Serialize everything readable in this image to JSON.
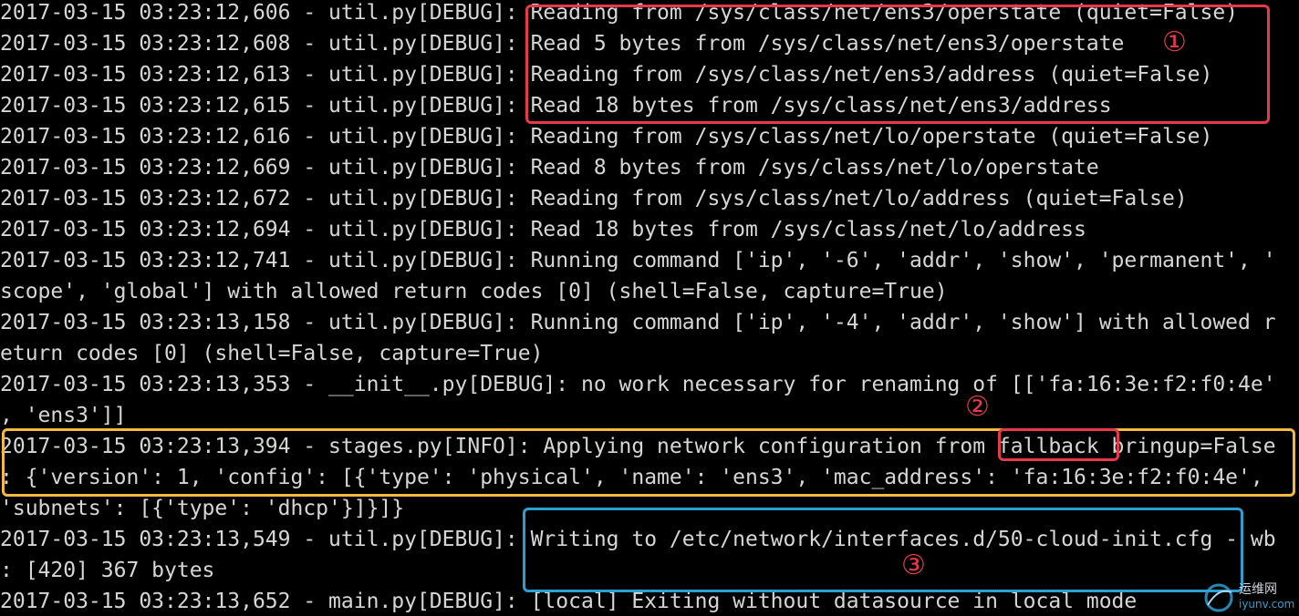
{
  "terminal": {
    "lines": [
      "2017-03-15 03:23:12,606 - util.py[DEBUG]: Reading from /sys/class/net/ens3/operstate (quiet=False)",
      "2017-03-15 03:23:12,608 - util.py[DEBUG]: Read 5 bytes from /sys/class/net/ens3/operstate",
      "2017-03-15 03:23:12,613 - util.py[DEBUG]: Reading from /sys/class/net/ens3/address (quiet=False)",
      "2017-03-15 03:23:12,615 - util.py[DEBUG]: Read 18 bytes from /sys/class/net/ens3/address",
      "2017-03-15 03:23:12,616 - util.py[DEBUG]: Reading from /sys/class/net/lo/operstate (quiet=False)",
      "2017-03-15 03:23:12,669 - util.py[DEBUG]: Read 8 bytes from /sys/class/net/lo/operstate",
      "2017-03-15 03:23:12,672 - util.py[DEBUG]: Reading from /sys/class/net/lo/address (quiet=False)",
      "2017-03-15 03:23:12,694 - util.py[DEBUG]: Read 18 bytes from /sys/class/net/lo/address",
      "2017-03-15 03:23:12,741 - util.py[DEBUG]: Running command ['ip', '-6', 'addr', 'show', 'permanent', '",
      "scope', 'global'] with allowed return codes [0] (shell=False, capture=True)",
      "2017-03-15 03:23:13,158 - util.py[DEBUG]: Running command ['ip', '-4', 'addr', 'show'] with allowed r",
      "eturn codes [0] (shell=False, capture=True)",
      "2017-03-15 03:23:13,353 - __init__.py[DEBUG]: no work necessary for renaming of [['fa:16:3e:f2:f0:4e'",
      ", 'ens3']]",
      "2017-03-15 03:23:13,394 - stages.py[INFO]: Applying network configuration from fallback bringup=False",
      ": {'version': 1, 'config': [{'type': 'physical', 'name': 'ens3', 'mac_address': 'fa:16:3e:f2:f0:4e',",
      "'subnets': [{'type': 'dhcp'}]}]}",
      "2017-03-15 03:23:13,549 - util.py[DEBUG]: Writing to /etc/network/interfaces.d/50-cloud-init.cfg - wb",
      ": [420] 367 bytes",
      "2017-03-15 03:23:13,652 - main.py[DEBUG]: [local] Exiting without datasource in local mode"
    ]
  },
  "annotations": {
    "marker_1": "①",
    "marker_2": "②",
    "marker_3": "③"
  },
  "watermark": {
    "site_name": "运维网",
    "url": "iyunv.com"
  },
  "colors": {
    "background": "#000000",
    "text": "#d6d6d6",
    "highlight_red": "#e8394a",
    "highlight_orange": "#f5b93d",
    "highlight_blue": "#2c9fd1"
  }
}
